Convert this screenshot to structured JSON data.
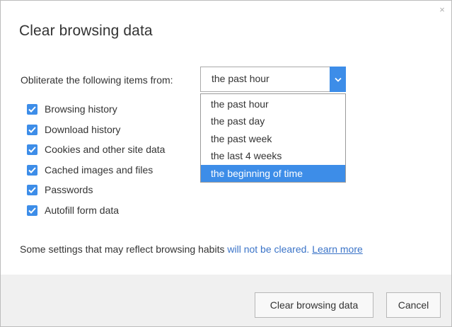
{
  "dialog": {
    "title": "Clear browsing data",
    "close_glyph": "×"
  },
  "from": {
    "label": "Obliterate the following items from:",
    "selected_value": "the past hour",
    "arrow_icon": "chevron-down-icon",
    "options": [
      {
        "label": "the past hour",
        "selected": false
      },
      {
        "label": "the past day",
        "selected": false
      },
      {
        "label": "the past week",
        "selected": false
      },
      {
        "label": "the last 4 weeks",
        "selected": false
      },
      {
        "label": "the beginning of time",
        "selected": true
      }
    ]
  },
  "items": [
    {
      "label": "Browsing history",
      "checked": true
    },
    {
      "label": "Download history",
      "checked": true
    },
    {
      "label": "Cookies and other site data",
      "checked": true
    },
    {
      "label": "Cached images and files",
      "checked": true
    },
    {
      "label": "Passwords",
      "checked": true
    },
    {
      "label": "Autofill form data",
      "checked": true
    }
  ],
  "info": {
    "prefix": "Some settings that may reflect browsing habits ",
    "highlight": "will not be cleared.",
    "separator": " ",
    "learn_more": "Learn more"
  },
  "buttons": {
    "clear": "Clear browsing data",
    "cancel": "Cancel"
  },
  "colors": {
    "accent": "#3d8de8",
    "link": "#3b74c8",
    "footer_bg": "#f0f0f0"
  }
}
